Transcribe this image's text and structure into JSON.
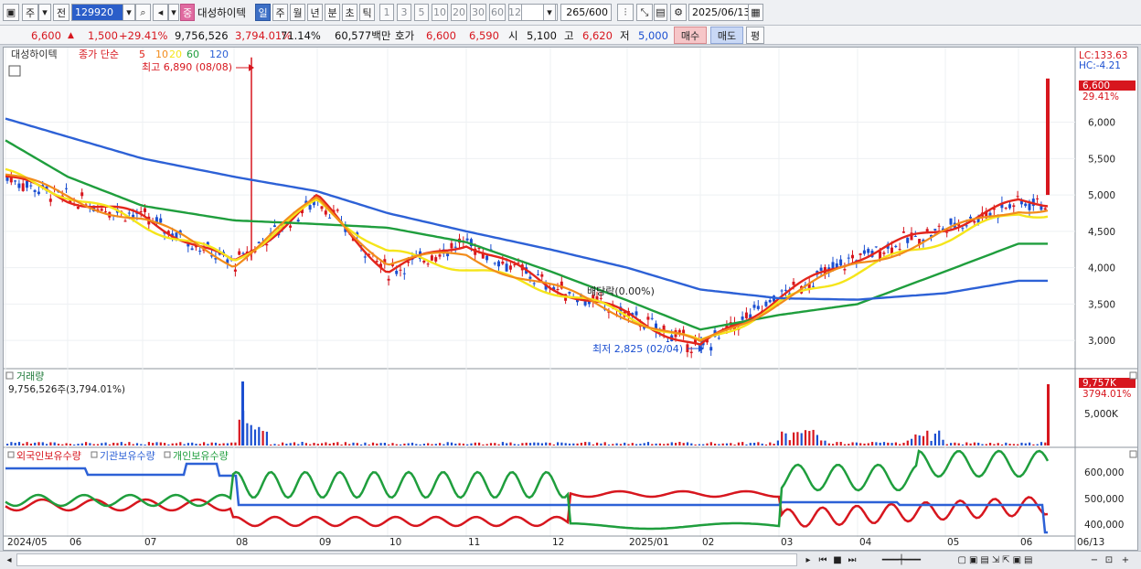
{
  "toolbar": {
    "period_main": "주",
    "period_prev": "전",
    "stock_code": "129920",
    "mkt_badge": "중",
    "stock_name": "대성하이텍",
    "periods": [
      "일",
      "주",
      "월",
      "년",
      "분",
      "초",
      "틱"
    ],
    "active_period": "일",
    "intervals": [
      "1",
      "3",
      "5",
      "10",
      "20",
      "30",
      "60",
      "120"
    ],
    "count": "265",
    "count_max": "/600",
    "date": "2025/06/13"
  },
  "quote": {
    "price": "6,600",
    "change": "1,500",
    "change_pct": "+29.41%",
    "volume": "9,756,526",
    "volume_ratio": "3,794.01%",
    "strength": "71.14%",
    "amount": "60,577백만",
    "hoga_label": "호가",
    "ask": "6,600",
    "bid": "6,590",
    "open_label": "시",
    "open": "5,100",
    "high_label": "고",
    "high": "6,620",
    "low_label": "저",
    "low": "5,000",
    "buy_label": "매수",
    "sell_label": "매도",
    "eval_label": "평"
  },
  "chart_header": {
    "stock_name": "대성하이텍",
    "ma_prefix": "종가 단순",
    "ma_periods": [
      {
        "label": "5",
        "color": "#e3261c"
      },
      {
        "label": "10",
        "color": "#f28c1b"
      },
      {
        "label": "20",
        "color": "#f5e51a"
      },
      {
        "label": "60",
        "color": "#1f9e3d"
      },
      {
        "label": "120",
        "color": "#2d61d6"
      }
    ],
    "lc": "LC:133.63",
    "hc": "HC:-4.21"
  },
  "annotations": {
    "high": "최고 6,890 (08/08)",
    "low": "최저 2,825 (02/04)",
    "dividend": "배당락(0.00%)"
  },
  "price_badge": {
    "price": "6,600",
    "pct": "29.41%"
  },
  "volume_panel": {
    "title": "거래량",
    "value": "9,756,526주(3,794.01%)",
    "badge_value": "9,757K",
    "badge_pct": "3794.01%",
    "axis_label": "5,000K"
  },
  "holdings_panel": {
    "legend": [
      {
        "label": "외국인보유수량",
        "color": "#d7161e"
      },
      {
        "label": "기관보유수량",
        "color": "#2d61d6"
      },
      {
        "label": "개인보유수량",
        "color": "#1f9e3d"
      }
    ],
    "axis": [
      "600,000",
      "500,000",
      "400,000"
    ]
  },
  "x_axis": [
    "2024/05",
    "06",
    "07",
    "08",
    "09",
    "10",
    "11",
    "12",
    "2025/01",
    "02",
    "03",
    "04",
    "05",
    "06",
    "06/13"
  ],
  "chart_data": {
    "type": "line",
    "title": "대성하이텍",
    "y_axis": [
      "6,000",
      "5,500",
      "5,000",
      "4,500",
      "4,000",
      "3,500",
      "3,000"
    ],
    "ylim": [
      2650,
      6950
    ],
    "x": [
      "2024/05",
      "06",
      "07",
      "08",
      "09",
      "10",
      "11",
      "12",
      "2025/01",
      "02",
      "03",
      "04",
      "05",
      "06"
    ],
    "series": [
      {
        "name": "5",
        "values": [
          5250,
          4950,
          4700,
          4050,
          4950,
          3950,
          4350,
          3750,
          3350,
          2900,
          3600,
          4150,
          4550,
          4900
        ]
      },
      {
        "name": "20",
        "values": [
          5300,
          5000,
          4600,
          4100,
          4900,
          4200,
          4000,
          3700,
          3350,
          2950,
          3500,
          3950,
          4400,
          4750
        ]
      },
      {
        "name": "60",
        "values": [
          5750,
          5250,
          4850,
          4650,
          4600,
          4550,
          4350,
          3950,
          3550,
          3150,
          3350,
          3500,
          3950,
          4330
        ]
      },
      {
        "name": "120",
        "values": [
          6050,
          5800,
          5500,
          5250,
          5050,
          4750,
          4500,
          4250,
          4000,
          3700,
          3580,
          3560,
          3650,
          3820
        ]
      }
    ],
    "highlights": {
      "high": 6890,
      "low": 2825,
      "last": 6600
    }
  }
}
